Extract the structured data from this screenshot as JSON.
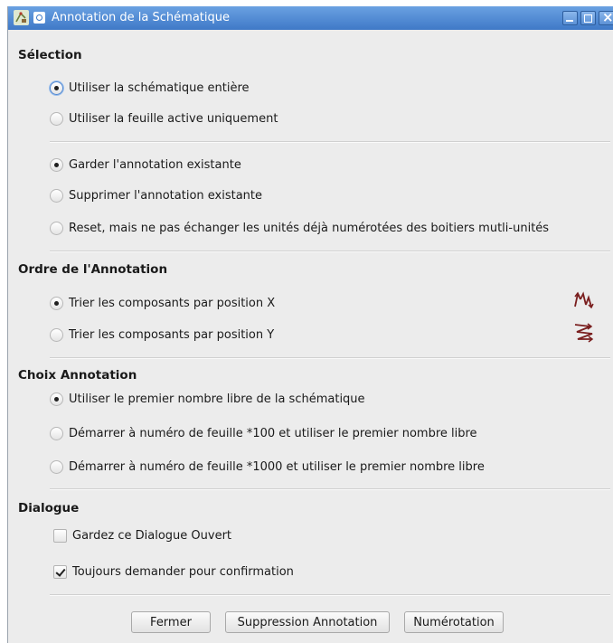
{
  "window": {
    "title": "Annotation de la Schématique"
  },
  "selection": {
    "title": "Sélection",
    "options": [
      {
        "label": "Utiliser la schématique entière",
        "checked": true
      },
      {
        "label": "Utiliser la feuille active uniquement",
        "checked": false
      }
    ]
  },
  "annotation_mode": {
    "options": [
      {
        "label": "Garder l'annotation existante",
        "checked": true
      },
      {
        "label": "Supprimer l'annotation existante",
        "checked": false
      },
      {
        "label": "Reset, mais ne pas échanger les unités déjà numérotées des boitiers mutli-unités",
        "checked": false
      }
    ]
  },
  "order": {
    "title": "Ordre de l'Annotation",
    "options": [
      {
        "label": "Trier les composants par position X",
        "checked": true
      },
      {
        "label": "Trier les composants par position Y",
        "checked": false
      }
    ]
  },
  "choice": {
    "title": "Choix Annotation",
    "options": [
      {
        "label": "Utiliser le premier nombre libre de la schématique",
        "checked": true
      },
      {
        "label": "Démarrer à numéro de feuille *100 et utiliser le premier nombre libre",
        "checked": false
      },
      {
        "label": "Démarrer à numéro de feuille *1000 et utiliser le premier nombre libre",
        "checked": false
      }
    ]
  },
  "dialog": {
    "title": "Dialogue",
    "options": [
      {
        "label": "Gardez ce Dialogue Ouvert",
        "checked": false
      },
      {
        "label": "Toujours demander pour confirmation",
        "checked": true
      }
    ]
  },
  "buttons": {
    "close": "Fermer",
    "clear": "Suppression Annotation",
    "annotate": "Numérotation"
  },
  "icons": {
    "app": "kicad-eeschema-icon",
    "sort_x": "sort-by-x-icon",
    "sort_y": "sort-by-y-icon"
  },
  "colors": {
    "titlebar": "#4f88d4",
    "window_bg": "#ececec",
    "sort_icon": "#7a1f1f"
  }
}
